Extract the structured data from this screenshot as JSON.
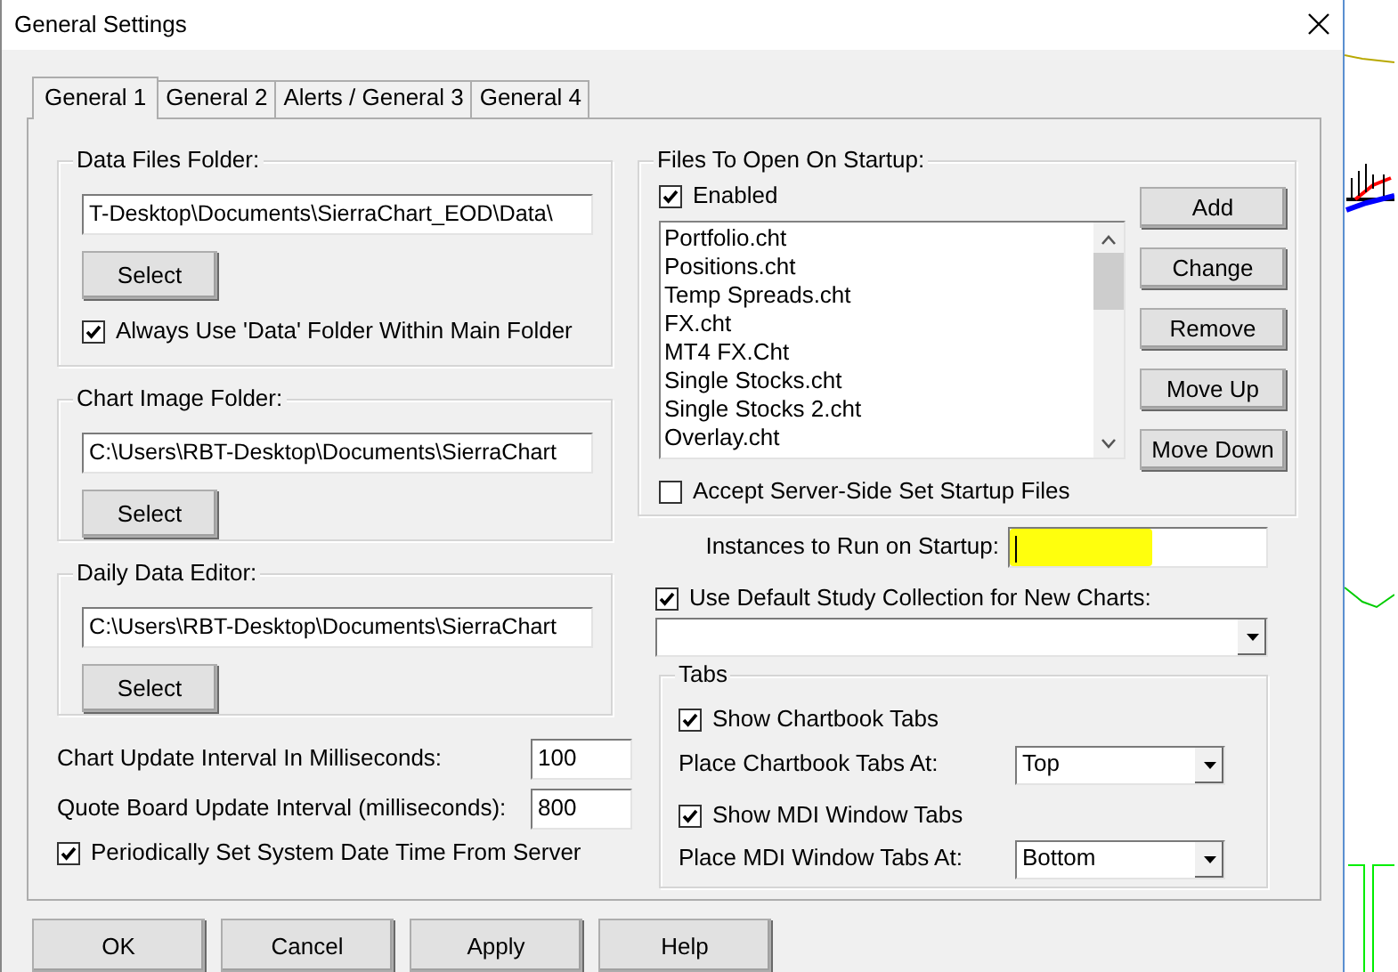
{
  "window": {
    "title": "General Settings"
  },
  "tabs": [
    {
      "label": "General 1",
      "selected": true
    },
    {
      "label": "General 2",
      "selected": false
    },
    {
      "label": "Alerts / General 3",
      "selected": false
    },
    {
      "label": "General 4",
      "selected": false
    }
  ],
  "data_files_folder": {
    "title": "Data Files Folder:",
    "path": "T-Desktop\\Documents\\SierraChart_EOD\\Data\\",
    "button": "Select",
    "always_use_data": {
      "label": "Always Use 'Data' Folder Within Main Folder",
      "checked": true
    }
  },
  "chart_image_folder": {
    "title": "Chart Image Folder:",
    "path": "C:\\Users\\RBT-Desktop\\Documents\\SierraChart",
    "button": "Select"
  },
  "daily_data_editor": {
    "title": "Daily Data Editor:",
    "path": "C:\\Users\\RBT-Desktop\\Documents\\SierraChart",
    "button": "Select"
  },
  "intervals": [
    {
      "label": "Chart Update Interval In Milliseconds:",
      "value": "100"
    },
    {
      "label": "Quote Board Update Interval (milliseconds):",
      "value": "800"
    }
  ],
  "periodically_set_time": {
    "label": "Periodically Set System Date Time From Server",
    "checked": true
  },
  "startup_files": {
    "title": "Files To Open On Startup:",
    "enabled": {
      "label": "Enabled",
      "checked": true
    },
    "files": [
      "Portfolio.cht",
      "Positions.cht",
      "Temp Spreads.cht",
      "FX.cht",
      "MT4 FX.Cht",
      "Single Stocks.cht",
      "Single Stocks 2.cht",
      "Overlay.cht"
    ],
    "buttons": [
      "Add",
      "Change",
      "Remove",
      "Move Up",
      "Move Down"
    ],
    "accept_server_side": {
      "label": "Accept Server-Side Set Startup Files",
      "checked": false
    }
  },
  "instances": {
    "label": "Instances to Run on Startup:",
    "focused": true,
    "highlighted": true
  },
  "default_study_collection": {
    "label": "Use Default Study Collection for New Charts:",
    "checked": true
  },
  "tabs_group": {
    "title": "Tabs",
    "show_chartbook_tabs": {
      "label": "Show Chartbook Tabs",
      "checked": true
    },
    "place_chartbook_tabs": {
      "label": "Place Chartbook Tabs At:",
      "value": "Top"
    },
    "show_mdi_tabs": {
      "label": "Show MDI Window Tabs",
      "checked": true
    },
    "place_mdi_tabs": {
      "label": "Place MDI Window Tabs At:",
      "value": "Bottom"
    }
  },
  "buttons": [
    "OK",
    "Cancel",
    "Apply",
    "Help"
  ]
}
